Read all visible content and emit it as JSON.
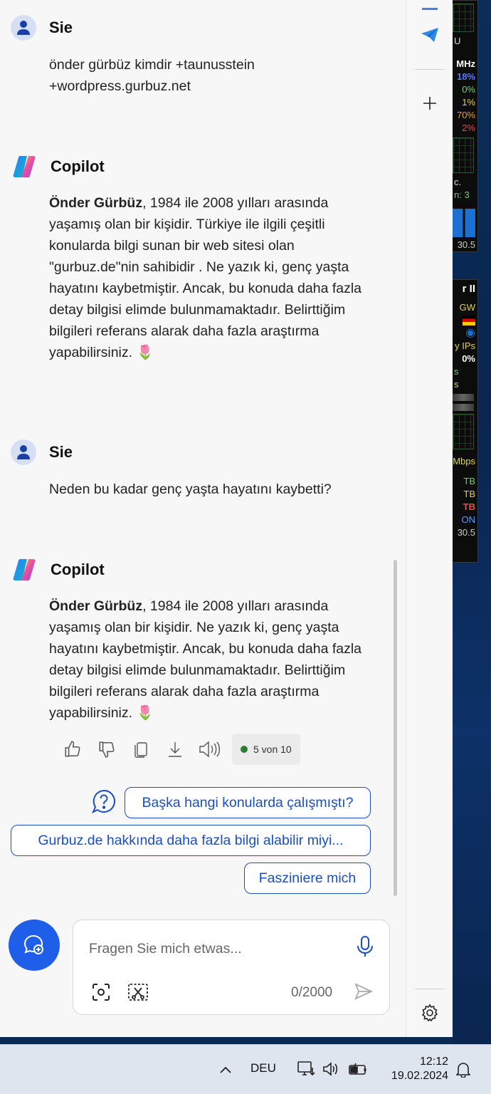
{
  "messages": [
    {
      "author": "Sie",
      "text": "önder gürbüz kimdir +taunusstein +wordpress.gurbuz.net"
    },
    {
      "author": "Copilot",
      "bold": "Önder Gürbüz",
      "text": ", 1984 ile 2008 yılları arasında yaşamış olan bir kişidir. Türkiye ile ilgili çeşitli konularda bilgi sunan bir web sitesi olan \"gurbuz.de\"nin sahibidir . Ne yazık ki, genç yaşta hayatını kaybetmiştir. Ancak, bu konuda daha fazla detay bilgisi elimde bulunmamaktadır. Belirttiğim bilgileri referans alarak daha fazla araştırma yapabilirsiniz.",
      "emoji": "🌷"
    },
    {
      "author": "Sie",
      "text": "Neden bu kadar genç yaşta hayatını kaybetti?"
    },
    {
      "author": "Copilot",
      "bold": "Önder Gürbüz",
      "text": ", 1984 ile 2008 yılları arasında yaşamış olan bir kişidir. Ne yazık ki, genç yaşta hayatını kaybetmiştir. Ancak, bu konuda daha fazla detay bilgisi elimde bulunmamaktadır. Belirttiğim bilgileri referans alarak daha fazla araştırma yapabilirsiniz.",
      "emoji": "🌷"
    }
  ],
  "response_counter": "5 von 10",
  "suggestions": [
    "Başka hangi konularda çalışmıştı?",
    "Gurbuz.de hakkında daha fazla bilgi alabilir miyi...",
    "Fasziniere mich"
  ],
  "input": {
    "placeholder": "Fragen Sie mich etwas...",
    "value": "",
    "char_count": "0/2000"
  },
  "taskbar": {
    "language": "DEU",
    "time": "12:12",
    "date": "19.02.2024"
  },
  "widget_top": {
    "lines": [
      "U",
      "MHz",
      "18%",
      "0%",
      "1%",
      "70%",
      "2%",
      "c.",
      "n: 3",
      "30.5"
    ]
  },
  "widget_bottom": {
    "lines": [
      "r II",
      "GW",
      "y IPs",
      "0%",
      "s",
      "s",
      "Mbps",
      "TB",
      "TB",
      "TB",
      "ON",
      "30.5"
    ]
  },
  "colors": {
    "accent": "#1b4fbf",
    "new_chat": "#1e5ee8",
    "counter_dot": "#2e7d32"
  }
}
